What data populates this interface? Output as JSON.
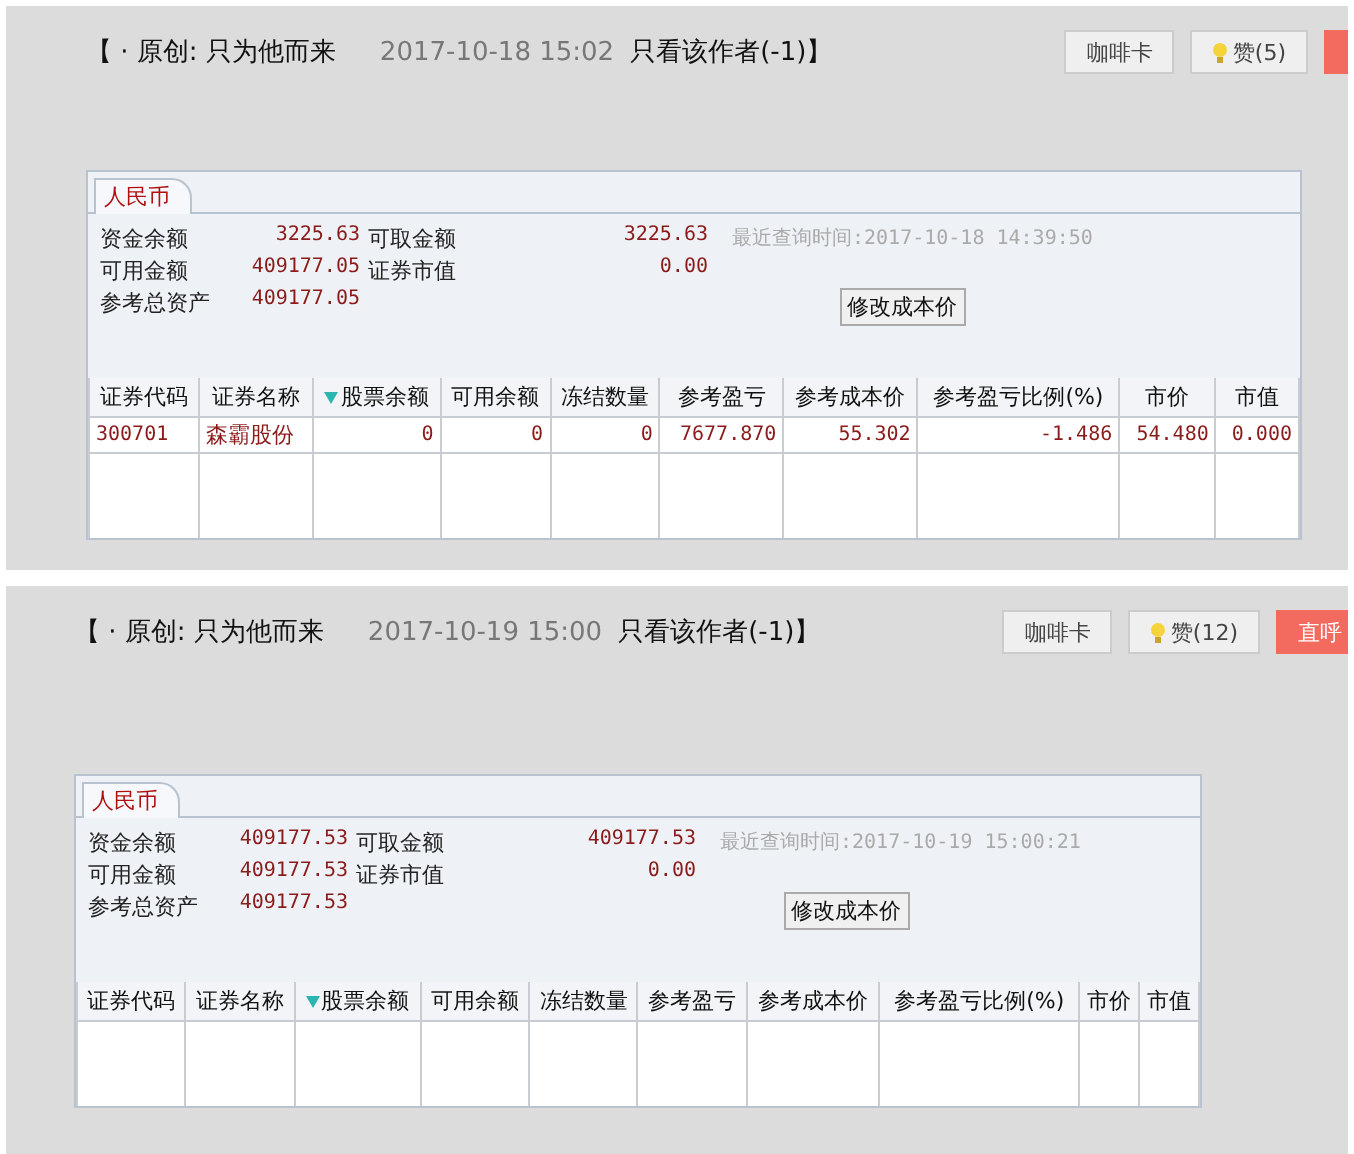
{
  "posts": [
    {
      "title": "【 · 原创: 只为他而来",
      "time": "2017-10-18 15:02",
      "author_filter": "只看该作者(-1)】",
      "buttons": [
        {
          "kind": "plain",
          "label": "咖啡卡"
        },
        {
          "kind": "like",
          "label": "赞(5)"
        },
        {
          "kind": "call"
        }
      ],
      "account": {
        "tab": "人民币",
        "fields": [
          {
            "label": "资金余额",
            "value": "3225.63"
          },
          {
            "label": "可取金额",
            "value": "3225.63"
          },
          {
            "label": "可用金额",
            "value": "409177.05"
          },
          {
            "label": "证券市值",
            "value": "0.00"
          },
          {
            "label": "参考总资产",
            "value": "409177.05"
          }
        ],
        "query_time": "最近查询时间:2017-10-18 14:39:50",
        "button": "修改成本价",
        "columns": [
          {
            "label": "证券代码",
            "sorted": false
          },
          {
            "label": "证券名称",
            "sorted": false
          },
          {
            "label": "股票余额",
            "sorted": true
          },
          {
            "label": "可用余额",
            "sorted": false
          },
          {
            "label": "冻结数量",
            "sorted": false
          },
          {
            "label": "参考盈亏",
            "sorted": false
          },
          {
            "label": "参考成本价",
            "sorted": false
          },
          {
            "label": "参考盈亏比例(%)",
            "sorted": false
          },
          {
            "label": "市价",
            "sorted": false
          },
          {
            "label": "市值",
            "sorted": false
          }
        ],
        "rows": [
          [
            "300701",
            "森霸股份",
            "0",
            "0",
            "0",
            "7677.870",
            "55.302",
            "-1.486",
            "54.480",
            "0.000"
          ]
        ]
      }
    },
    {
      "title": "【 · 原创: 只为他而来",
      "time": "2017-10-19 15:00",
      "author_filter": "只看该作者(-1)】",
      "buttons": [
        {
          "kind": "plain",
          "label": "咖啡卡"
        },
        {
          "kind": "like",
          "label": "赞(12)"
        },
        {
          "kind": "call",
          "label": "直呼"
        }
      ],
      "account": {
        "tab": "人民币",
        "fields": [
          {
            "label": "资金余额",
            "value": "409177.53"
          },
          {
            "label": "可取金额",
            "value": "409177.53"
          },
          {
            "label": "可用金额",
            "value": "409177.53"
          },
          {
            "label": "证券市值",
            "value": "0.00"
          },
          {
            "label": "参考总资产",
            "value": "409177.53"
          }
        ],
        "query_time": "最近查询时间:2017-10-19 15:00:21",
        "button": "修改成本价",
        "columns": [
          {
            "label": "证券代码",
            "sorted": false
          },
          {
            "label": "证券名称",
            "sorted": false
          },
          {
            "label": "股票余额",
            "sorted": true
          },
          {
            "label": "可用余额",
            "sorted": false
          },
          {
            "label": "冻结数量",
            "sorted": false
          },
          {
            "label": "参考盈亏",
            "sorted": false
          },
          {
            "label": "参考成本价",
            "sorted": false
          },
          {
            "label": "参考盈亏比例(%)",
            "sorted": false
          },
          {
            "label": "市价",
            "sorted": false
          },
          {
            "label": "市值",
            "sorted": false
          }
        ]
      }
    }
  ]
}
